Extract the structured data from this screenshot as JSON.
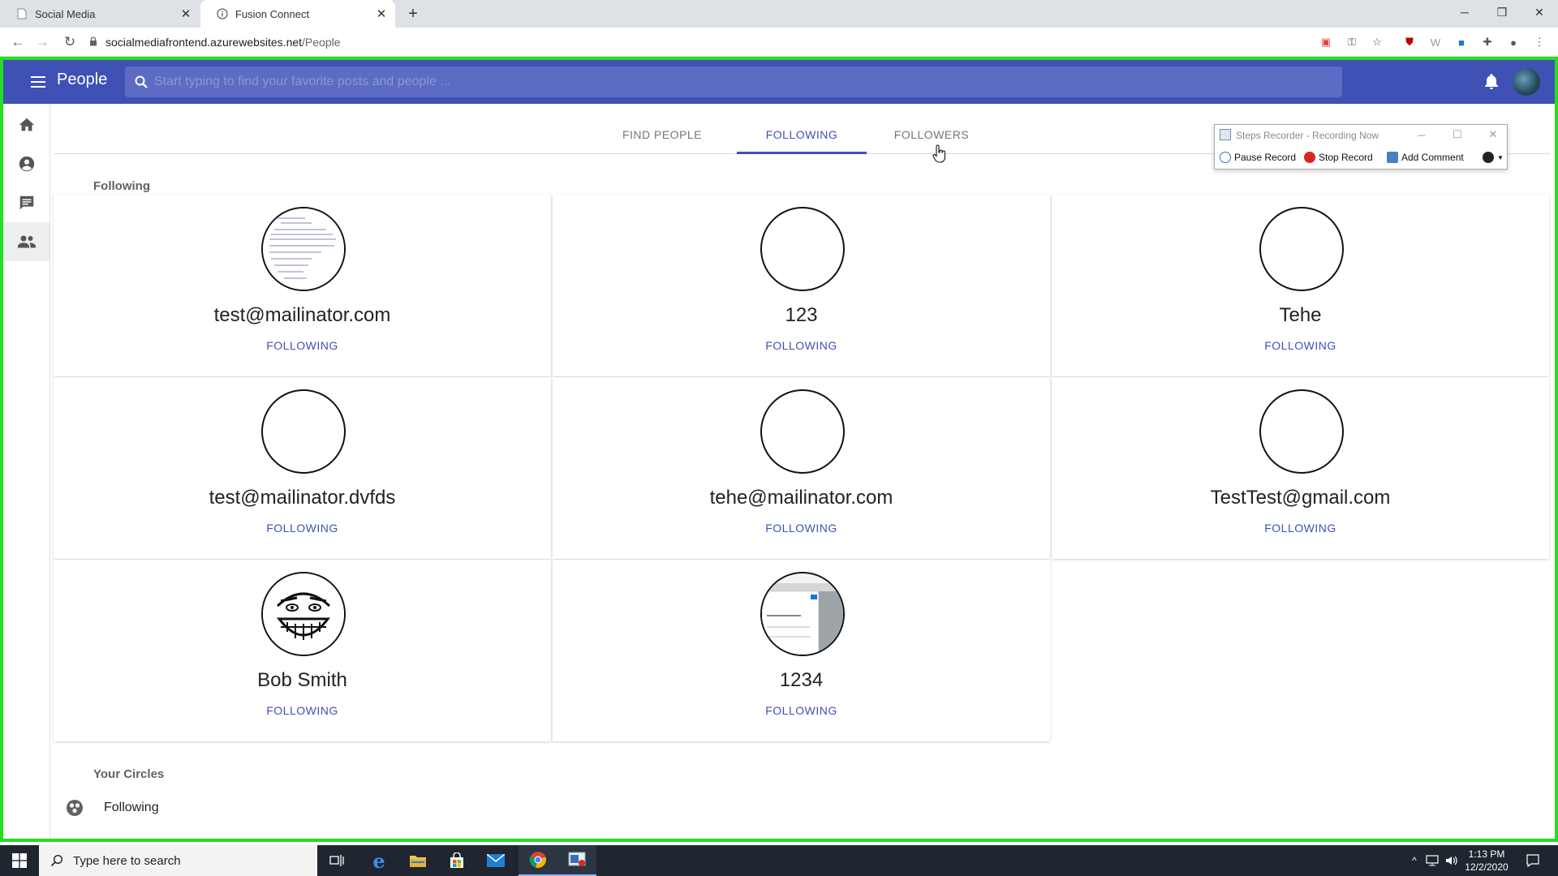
{
  "browser": {
    "tabs": [
      {
        "title": "Social Media",
        "active": false
      },
      {
        "title": "Fusion Connect",
        "active": true
      }
    ],
    "url_host": "socialmediafrontend.azurewebsites.net",
    "url_path": "/People"
  },
  "header": {
    "title": "People",
    "search_placeholder": "Start typing to find your favorite posts and people ..."
  },
  "sidebar": {
    "items": [
      {
        "icon": "home-icon",
        "active": false
      },
      {
        "icon": "account-circle-icon",
        "active": false
      },
      {
        "icon": "chat-icon",
        "active": false
      },
      {
        "icon": "people-icon",
        "active": true
      }
    ]
  },
  "tabs": [
    {
      "label": "FIND PEOPLE",
      "active": false
    },
    {
      "label": "FOLLOWING",
      "active": true
    },
    {
      "label": "FOLLOWERS",
      "active": false
    }
  ],
  "following": {
    "section_title": "Following",
    "people": [
      {
        "name": "test@mailinator.com",
        "status": "FOLLOWING",
        "avatar": "document-screenshot"
      },
      {
        "name": "123",
        "status": "FOLLOWING",
        "avatar": "empty"
      },
      {
        "name": "Tehe",
        "status": "FOLLOWING",
        "avatar": "empty"
      },
      {
        "name": "test@mailinator.dvfds",
        "status": "FOLLOWING",
        "avatar": "empty"
      },
      {
        "name": "tehe@mailinator.com",
        "status": "FOLLOWING",
        "avatar": "empty"
      },
      {
        "name": "TestTest@gmail.com",
        "status": "FOLLOWING",
        "avatar": "empty"
      },
      {
        "name": "Bob Smith",
        "status": "FOLLOWING",
        "avatar": "meme-face"
      },
      {
        "name": "1234",
        "status": "FOLLOWING",
        "avatar": "app-screenshot"
      }
    ]
  },
  "circles": {
    "section_title": "Your Circles",
    "items": [
      {
        "label": "Following"
      }
    ]
  },
  "steps_recorder": {
    "title": "Steps Recorder - Recording Now",
    "pause": "Pause Record",
    "stop": "Stop Record",
    "comment": "Add Comment"
  },
  "taskbar": {
    "search_text": "Type here to search",
    "time": "1:13 PM",
    "date": "12/2/2020"
  },
  "colors": {
    "primary": "#3f51b5",
    "frame": "#22e01f",
    "taskbar": "#1f2630"
  }
}
